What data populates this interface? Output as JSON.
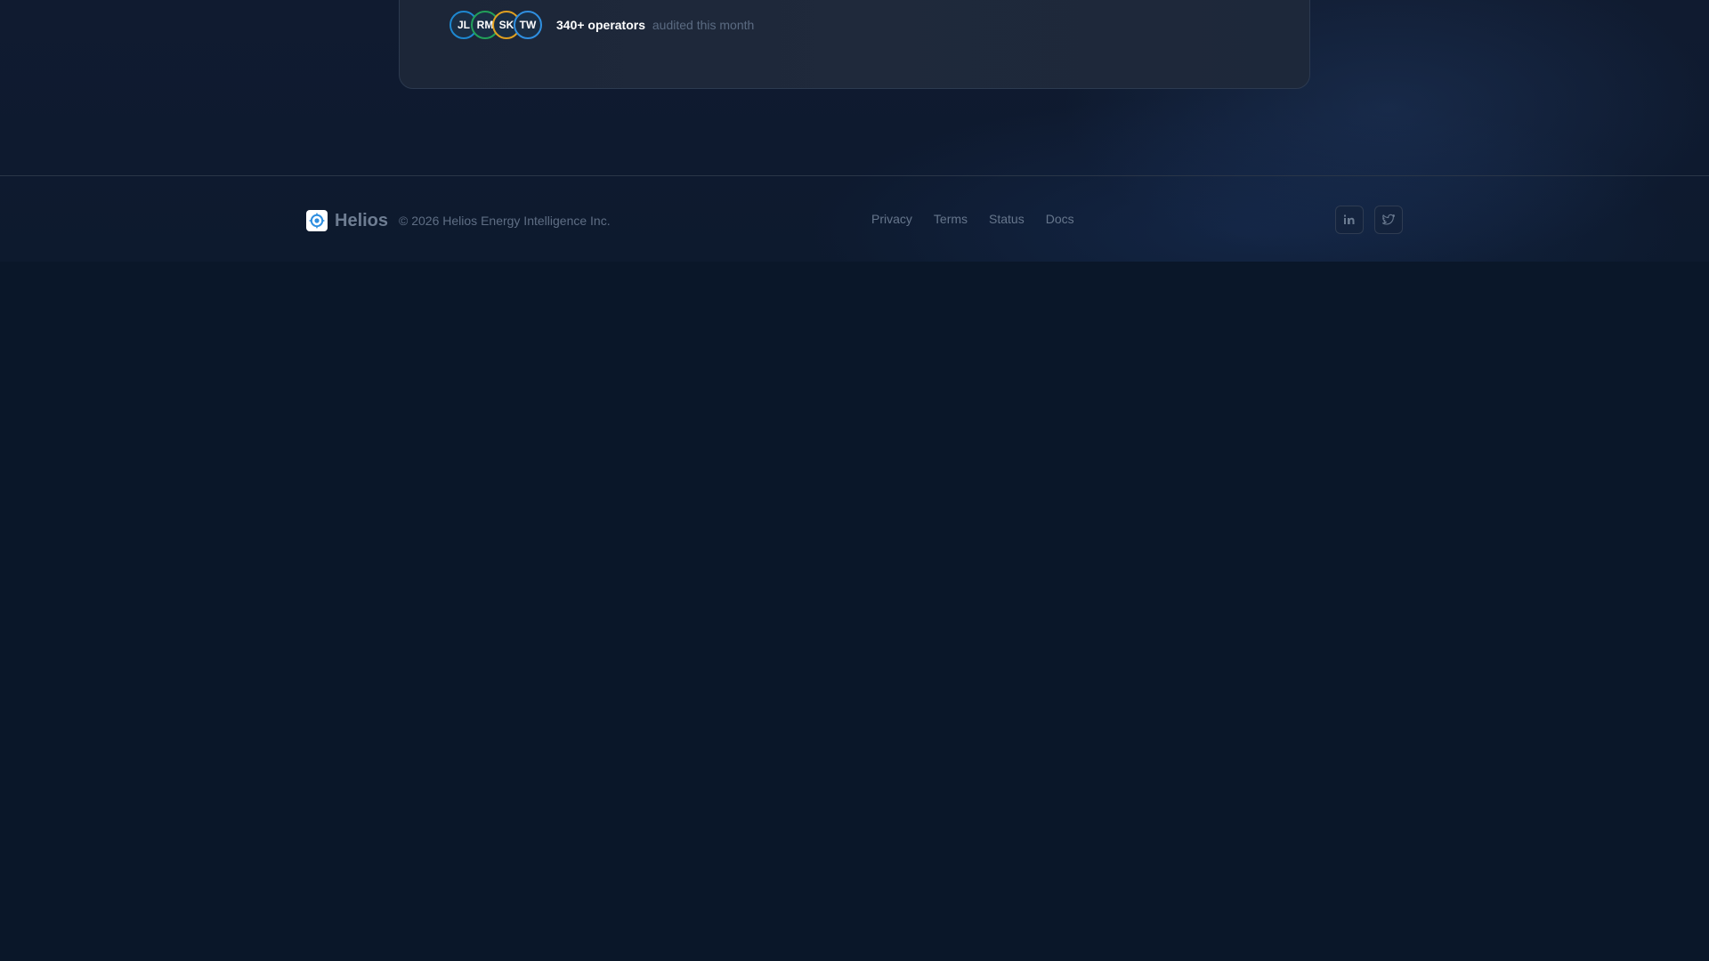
{
  "social_proof": {
    "avatars": [
      {
        "initials": "JL",
        "color": "#1e88d0"
      },
      {
        "initials": "RM",
        "color": "#22a15a"
      },
      {
        "initials": "SK",
        "color": "#e0a020"
      },
      {
        "initials": "TW",
        "color": "#2f8fe0"
      }
    ],
    "count_label": "340+ operators",
    "suffix": "audited this month"
  },
  "footer": {
    "brand_name": "Helios",
    "copyright": "© 2026 Helios Energy Intelligence Inc.",
    "links": [
      {
        "label": "Privacy"
      },
      {
        "label": "Terms"
      },
      {
        "label": "Status"
      },
      {
        "label": "Docs"
      }
    ],
    "socials": [
      {
        "icon": "linkedin-icon"
      },
      {
        "icon": "twitter-icon"
      }
    ]
  },
  "colors": {
    "background": "#0a1729",
    "card": "#1f293b",
    "brand_logo_accent": "#2f8fe0"
  }
}
